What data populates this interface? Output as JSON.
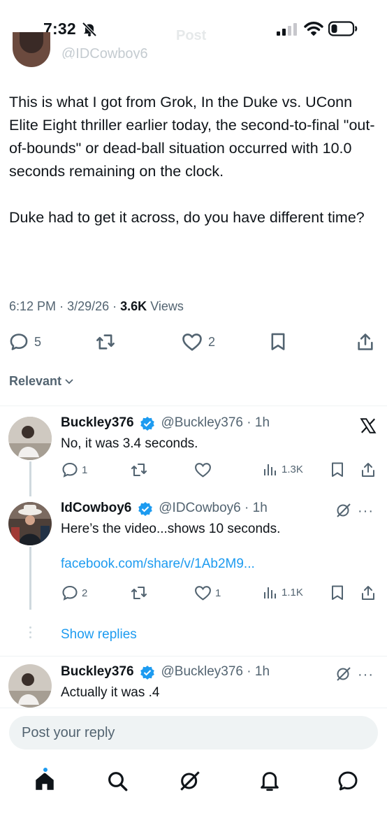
{
  "status_bar": {
    "time": "7:32"
  },
  "header": {
    "title": "Post",
    "handle": "@IDCowboy6"
  },
  "main_post": {
    "text": "This is what I got from Grok, In the Duke vs. UConn Elite Eight thriller earlier today, the second-to-final \"out-of-bounds\" or dead-ball situation occurred with 10.0 seconds remaining on the clock.\n\nDuke had to get it across, do you have different time?",
    "time": "6:12 PM",
    "date": "3/29/26",
    "views_count": "3.6K",
    "views_label": "Views",
    "reply_count": "5",
    "like_count": "2"
  },
  "sort": {
    "label": "Relevant"
  },
  "replies": [
    {
      "name": "Buckley376",
      "handle": "@Buckley376",
      "age": "1h",
      "text": "No, it was 3.4 seconds.",
      "reply_count": "1",
      "like_count": "",
      "view_count": "1.3K"
    },
    {
      "name": "IdCowboy6",
      "handle": "@IDCowboy6",
      "age": "1h",
      "text": "Here’s the video...shows 10 seconds.",
      "link": "facebook.com/share/v/1Ab2M9...",
      "reply_count": "2",
      "like_count": "1",
      "view_count": "1.1K"
    },
    {
      "name": "Buckley376",
      "handle": "@Buckley376",
      "age": "1h",
      "text": "Actually it was .4"
    }
  ],
  "show_replies": "Show replies",
  "composer": {
    "placeholder": "Post your reply"
  },
  "colors": {
    "accent": "#1d9bf0",
    "text": "#0f1419",
    "muted": "#536471",
    "divider": "#eff3f4"
  },
  "icons": {
    "nav": [
      "home-icon",
      "search-icon",
      "grok-icon",
      "bell-icon",
      "messages-icon"
    ]
  }
}
